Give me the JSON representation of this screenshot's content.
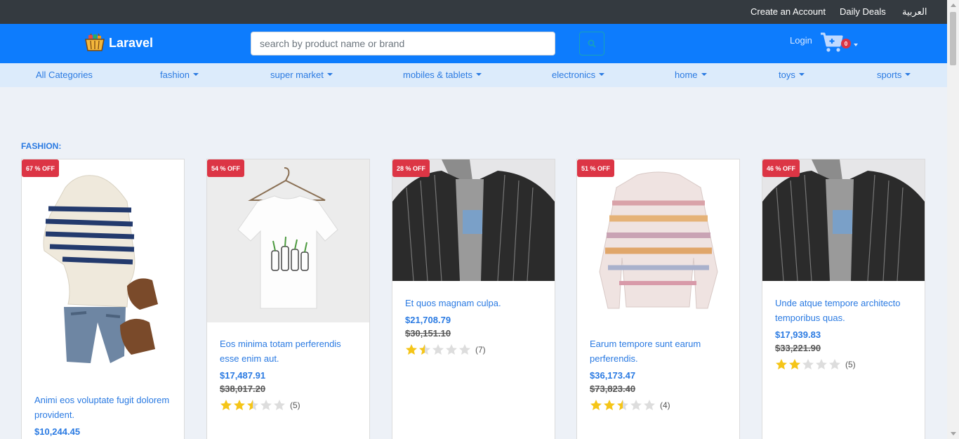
{
  "topbar": {
    "create_account": "Create an Account",
    "daily_deals": "Daily Deals",
    "language": "العربية"
  },
  "header": {
    "brand": "Laravel",
    "search_placeholder": "search by product name or brand",
    "login": "Login",
    "cart_count": "0"
  },
  "categories": [
    "All Categories",
    "fashion",
    "super market",
    "mobiles & tablets",
    "electronics",
    "home",
    "toys",
    "sports"
  ],
  "section": {
    "title": "FASHION:"
  },
  "products": [
    {
      "badge": "67 % OFF",
      "name": "Animi eos voluptate fugit dolorem provident.",
      "price": "$10,244.45",
      "old_price": "",
      "rating": 0,
      "reviews": "",
      "image": "kids-outfit-hoodie-jeans-boots"
    },
    {
      "badge": "54 % OFF",
      "name": "Eos minima totam perferendis esse enim aut.",
      "price": "$17,487.91",
      "old_price": "$38,017.20",
      "rating": 2.5,
      "reviews": "(5)",
      "image": "white-tshirt-on-hanger"
    },
    {
      "badge": "28 % OFF",
      "name": "Et quos magnam culpa.",
      "price": "$21,708.79",
      "old_price": "$30,151.10",
      "rating": 1.5,
      "reviews": "(7)",
      "image": "pinstripe-blazer-mannequin"
    },
    {
      "badge": "51 % OFF",
      "name": "Earum tempore sunt earum perferendis.",
      "price": "$36,173.47",
      "old_price": "$73,823.40",
      "rating": 2.5,
      "reviews": "(4)",
      "image": "striped-knit-sweater"
    },
    {
      "badge": "46 % OFF",
      "name": "Unde atque tempore architecto temporibus quas.",
      "price": "$17,939.83",
      "old_price": "$33,221.90",
      "rating": 2,
      "reviews": "(5)",
      "image": "pinstripe-blazer-mannequin"
    }
  ],
  "colors": {
    "topbar": "#343a40",
    "header": "#0d7cfd",
    "link": "#2a7ae2",
    "badge": "#dc3545",
    "star": "#f5c518",
    "star_empty": "#dddddd"
  }
}
